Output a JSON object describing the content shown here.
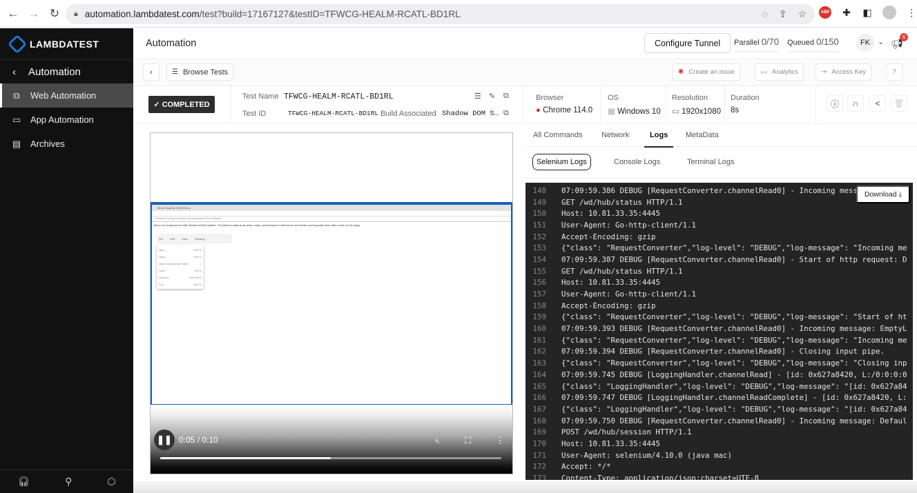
{
  "browser": {
    "url_host": "automation.lambdatest.com",
    "url_path": "/test?build=17167127&testID=TFWCG-HEALM-RCATL-BD1RL",
    "extensions": [
      "ABP"
    ]
  },
  "sidebar": {
    "brand": "LAMBDATEST",
    "section": "Automation",
    "items": [
      {
        "label": "Web Automation",
        "icon": "windows-icon",
        "active": true
      },
      {
        "label": "App Automation",
        "icon": "window-icon",
        "active": false
      },
      {
        "label": "Archives",
        "icon": "archive-icon",
        "active": false
      }
    ],
    "footer_icons": [
      "headset-icon",
      "key-icon",
      "integrations-icon"
    ]
  },
  "topbar": {
    "title": "Automation",
    "configure_tunnel": "Configure Tunnel",
    "parallel_label": "Parallel",
    "parallel_value": "0/70",
    "queued_label": "Queued",
    "queued_value": "0/150",
    "avatar_initials": "FK",
    "notification_count": "6"
  },
  "toolbar": {
    "browse_tests": "Browse Tests",
    "create_issue": "Create an issue",
    "analytics": "Analytics",
    "access_key": "Access Key",
    "help": "?"
  },
  "test_info": {
    "status": "COMPLETED",
    "test_name_label": "Test Name",
    "test_name": "TFWCG-HEALM-RCATL-BD1RL",
    "test_id_label": "Test ID",
    "test_id": "TFWCG-HEALM-RCATL-BD1RL",
    "build_label": "Build Associated",
    "build": "Shadow DOM S…",
    "browser_label": "Browser",
    "browser": "Chrome 114.0",
    "os_label": "OS",
    "os": "Windows 10",
    "resolution_label": "Resolution",
    "resolution": "1920x1080",
    "duration_label": "Duration",
    "duration": "8s"
  },
  "video": {
    "tab_title": "Menu Shadow DOM Demo",
    "info_bar": "Chrome is being controlled by automated test software.",
    "description": "Menu UI component is with Shadow DOM enabled. The Menu's markup structure, style, and behavior in this demo are hidden and separate from other code on the page.",
    "menubar": [
      "File",
      "Edit",
      "View",
      "Sending"
    ],
    "menu_items": [
      {
        "label": "New",
        "shortcut": "Ctrl+N"
      },
      {
        "label": "Open",
        "shortcut": "Ctrl+O"
      },
      {
        "label": "Open Containing Folder",
        "shortcut": ">"
      },
      {
        "label": "Save",
        "shortcut": "Ctrl+S"
      },
      {
        "label": "Save As...",
        "shortcut": "Ctrl+Alt+S"
      },
      {
        "label": "Exit",
        "shortcut": "Alt+F4"
      }
    ],
    "time": "0:05 / 0:10",
    "progress_fraction": 0.5
  },
  "panel": {
    "tabs": [
      "All Commands",
      "Network",
      "Logs",
      "MetaData"
    ],
    "active_tab": "Logs",
    "subtabs": [
      "Selenium Logs",
      "Console Logs",
      "Terminal Logs"
    ],
    "active_subtab": "Selenium Logs",
    "download": "Download ⤓"
  },
  "logs": [
    {
      "n": "148",
      "t": "07:09:59.386 DEBUG [RequestConverter.channelRead0] - Incoming message"
    },
    {
      "n": "149",
      "t": "GET /wd/hub/status HTTP/1.1"
    },
    {
      "n": "150",
      "t": "Host: 10.81.33.35:4445"
    },
    {
      "n": "151",
      "t": "User-Agent: Go-http-client/1.1"
    },
    {
      "n": "152",
      "t": "Accept-Encoding: gzip"
    },
    {
      "n": "153",
      "t": "{\"class\": \"RequestConverter\",\"log-level\": \"DEBUG\",\"log-message\": \"Incoming me"
    },
    {
      "n": "154",
      "t": "07:09:59.387 DEBUG [RequestConverter.channelRead0] - Start of http request: D"
    },
    {
      "n": "155",
      "t": "GET /wd/hub/status HTTP/1.1"
    },
    {
      "n": "156",
      "t": "Host: 10.81.33.35:4445"
    },
    {
      "n": "157",
      "t": "User-Agent: Go-http-client/1.1"
    },
    {
      "n": "158",
      "t": "Accept-Encoding: gzip"
    },
    {
      "n": "159",
      "t": "{\"class\": \"RequestConverter\",\"log-level\": \"DEBUG\",\"log-message\": \"Start of ht"
    },
    {
      "n": "160",
      "t": "07:09:59.393 DEBUG [RequestConverter.channelRead0] - Incoming message: EmptyL"
    },
    {
      "n": "161",
      "t": "{\"class\": \"RequestConverter\",\"log-level\": \"DEBUG\",\"log-message\": \"Incoming me"
    },
    {
      "n": "162",
      "t": "07:09:59.394 DEBUG [RequestConverter.channelRead0] - Closing input pipe."
    },
    {
      "n": "163",
      "t": "{\"class\": \"RequestConverter\",\"log-level\": \"DEBUG\",\"log-message\": \"Closing inp"
    },
    {
      "n": "164",
      "t": "07:09:59.745 DEBUG [LoggingHandler.channelRead] - [id: 0x627a8420, L:/0:0:0:0"
    },
    {
      "n": "165",
      "t": "{\"class\": \"LoggingHandler\",\"log-level\": \"DEBUG\",\"log-message\": \"[id: 0x627a84"
    },
    {
      "n": "166",
      "t": "07:09:59.747 DEBUG [LoggingHandler.channelReadComplete] - [id: 0x627a8420, L:"
    },
    {
      "n": "167",
      "t": "{\"class\": \"LoggingHandler\",\"log-level\": \"DEBUG\",\"log-message\": \"[id: 0x627a84"
    },
    {
      "n": "168",
      "t": "07:09:59.750 DEBUG [RequestConverter.channelRead0] - Incoming message: Defaul"
    },
    {
      "n": "169",
      "t": "POST /wd/hub/session HTTP/1.1"
    },
    {
      "n": "170",
      "t": "Host: 10.81.33.35:4445"
    },
    {
      "n": "171",
      "t": "User-Agent: selenium/4.10.0 (java mac)"
    },
    {
      "n": "172",
      "t": "Accept: */*"
    },
    {
      "n": "173",
      "t": "Content-Type: application/json;charset=UTF-8"
    }
  ]
}
